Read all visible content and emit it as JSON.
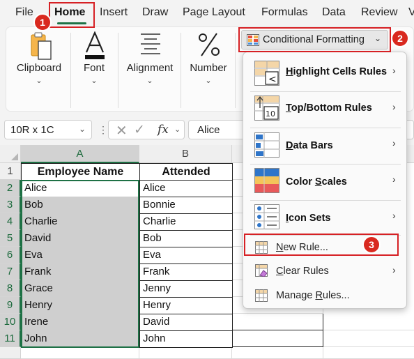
{
  "menu": {
    "tabs": [
      "File",
      "Home",
      "Insert",
      "Draw",
      "Page Layout",
      "Formulas",
      "Data",
      "Review",
      "V"
    ],
    "active": "Home"
  },
  "ribbon": {
    "groups": [
      "Clipboard",
      "Font",
      "Alignment",
      "Number"
    ],
    "conditional_formatting": "Conditional Formatting"
  },
  "formula_bar": {
    "name_box": "10R x 1C",
    "fx": "fx",
    "value": "Alice"
  },
  "grid": {
    "columns": [
      "A",
      "B"
    ],
    "rows": [
      "1",
      "2",
      "3",
      "4",
      "5",
      "6",
      "7",
      "8",
      "9",
      "10",
      "11"
    ],
    "header": [
      "Employee Name",
      "Attended"
    ],
    "data": [
      [
        "Alice",
        "Alice"
      ],
      [
        "Bob",
        "Bonnie"
      ],
      [
        "Charlie",
        "Charlie"
      ],
      [
        "David",
        "Bob"
      ],
      [
        "Eva",
        "Eva"
      ],
      [
        "Frank",
        "Frank"
      ],
      [
        "Grace",
        "Jenny"
      ],
      [
        "Henry",
        "Henry"
      ],
      [
        "Irene",
        "David"
      ],
      [
        "John",
        "John"
      ]
    ]
  },
  "dropdown": {
    "items": [
      {
        "label": "Highlight Cells Rules",
        "u": "H",
        "rest": "ighlight Cells Rules"
      },
      {
        "label": "Top/Bottom Rules",
        "u": "T",
        "rest": "op/Bottom Rules"
      },
      {
        "label": "Data Bars",
        "u": "D",
        "rest": "ata Bars"
      },
      {
        "label": "Color Scales",
        "pre": "Color ",
        "u": "S",
        "rest": "cales"
      },
      {
        "label": "Icon Sets",
        "u": "I",
        "rest": "con Sets"
      }
    ],
    "new_rule": {
      "u": "N",
      "rest": "ew Rule..."
    },
    "clear_rules": {
      "pre": "Clear Rules",
      "u": "C",
      "rest": "lear Rules"
    },
    "manage_rules": {
      "pre": "Manage ",
      "u": "R",
      "rest": "ules..."
    }
  },
  "badges": [
    "1",
    "2",
    "3"
  ],
  "colors": {
    "accent_green": "#1e7145",
    "callout_red": "#d62024",
    "selection_shade": "#cfcfcf"
  }
}
